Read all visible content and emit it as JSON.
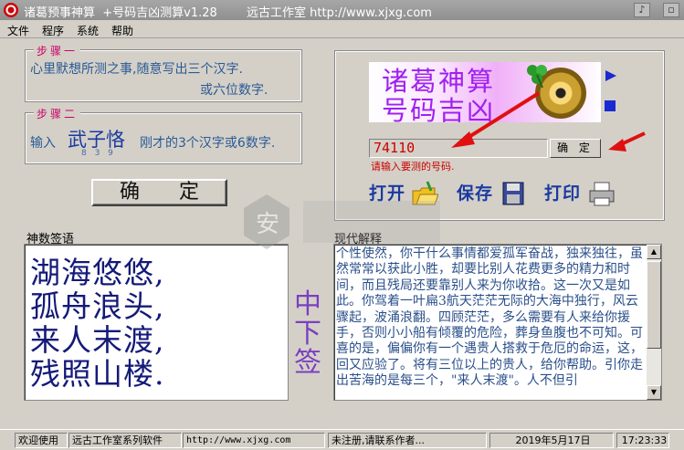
{
  "window": {
    "title": "诸葛预事神算  +号码吉凶测算v1.28",
    "subtitle": "远古工作室 http://www.xjxg.com"
  },
  "menu": [
    "文件",
    "程序",
    "系统",
    "帮助"
  ],
  "step1": {
    "title": "步骤一",
    "line1": "心里默想所测之事,随意写出三个汉字.",
    "line2": "或六位数字."
  },
  "step2": {
    "title": "步骤二",
    "prefix": "输入",
    "chars": "武子恪",
    "strokes": "8 3 9",
    "suffix": "刚才的3个汉字或6数字."
  },
  "confirm_main": "确  定",
  "logo": {
    "line1": "诸葛神算",
    "line2": "号码吉凶"
  },
  "number_input": {
    "value": "74110",
    "hint": "请输入要测的号码."
  },
  "confirm_small": "确 定",
  "toolbar": {
    "open": "打开",
    "save": "保存",
    "print": "打印"
  },
  "poem": {
    "label": "神数签语",
    "lines": [
      "湖海悠悠,",
      "孤舟浪头,",
      "来人末渡,",
      "残照山楼."
    ],
    "rank": [
      "中",
      "下",
      "签"
    ]
  },
  "modern": {
    "label": "现代解释",
    "text": "个性使然，你干什么事情都爱孤军奋战，独来独往，虽然常常以获此小胜，却要比别人花费更多的精力和时间，而且残局还要靠别人来为你收拾。这一次又是如此。你驾着一叶扁3航天茫茫无际的大海中独行，风云骤起，波涌浪翻。四顾茫茫，多么需要有人来给你援手，否则小小船有倾覆的危险，葬身鱼腹也不可知。可喜的是，偏偏你有一个遇贵人搭救于危厄的命运，这，回又应验了。将有三位以上的贵人，给你帮助。引你走出苦海的是每三个，\"来人末渡\"。人不但引"
  },
  "status": {
    "welcome": "欢迎使用",
    "brand": "远古工作室系列软件",
    "url": "http://www.xjxg.com",
    "reg": "未注册,请联系作者...",
    "date": "2019年5月17日",
    "time": "17:23:33"
  }
}
